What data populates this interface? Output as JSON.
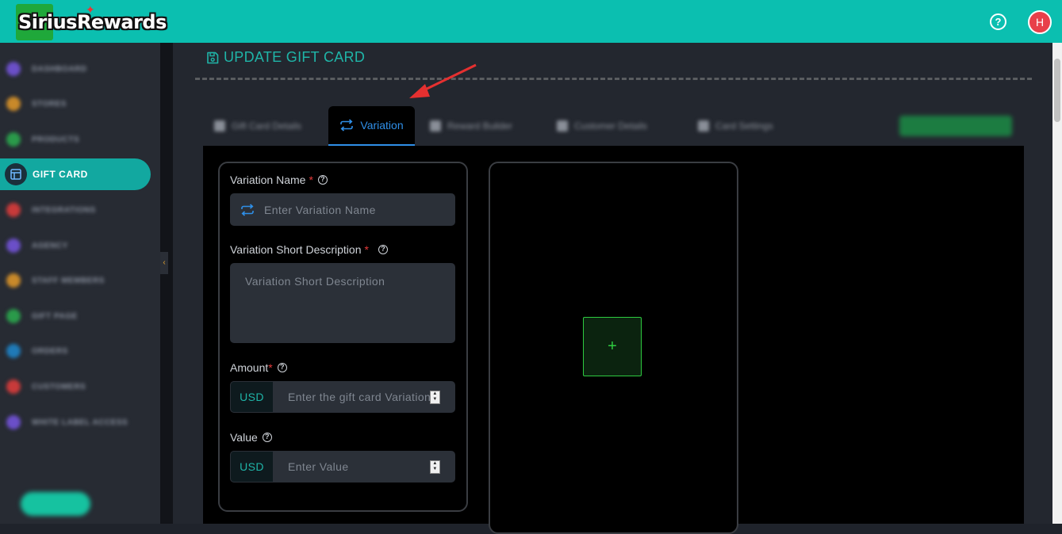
{
  "header": {
    "logo_text": "SiriusRewards",
    "help_icon": "question-circle-icon",
    "avatar_initial": "H",
    "brand_color": "#0bbfb0"
  },
  "sidebar": {
    "active_label": "GIFT CARD",
    "active_icon": "layout-icon"
  },
  "page": {
    "title": "UPDATE GIFT CARD",
    "title_icon": "save-icon"
  },
  "tabs": {
    "active_label": "Variation",
    "active_icon": "repeat-icon"
  },
  "form": {
    "variation_name_label": "Variation Name",
    "variation_name_placeholder": "Enter Variation Name",
    "short_desc_label": "Variation Short Description",
    "short_desc_placeholder": "Variation Short Description",
    "amount_label": "Amount",
    "amount_currency": "USD",
    "amount_placeholder": "Enter the gift card Variation",
    "value_label": "Value",
    "value_currency": "USD",
    "value_placeholder": "Enter Value",
    "required_mark": "*"
  },
  "image_panel": {
    "add_button_label": "+"
  }
}
